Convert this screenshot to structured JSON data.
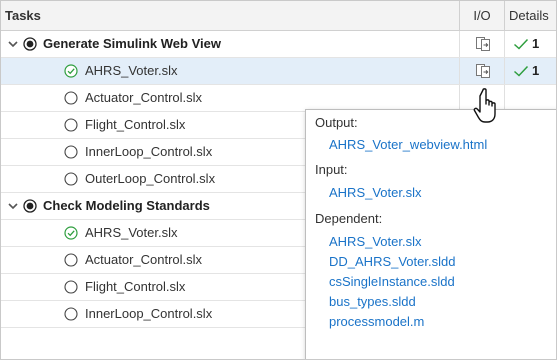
{
  "header": {
    "tasks": "Tasks",
    "io": "I/O",
    "details": "Details"
  },
  "rows": [
    {
      "label": "Generate Simulink Web View",
      "count": "1"
    },
    {
      "label": "AHRS_Voter.slx",
      "count": "1"
    },
    {
      "label": "Actuator_Control.slx"
    },
    {
      "label": "Flight_Control.slx"
    },
    {
      "label": "InnerLoop_Control.slx"
    },
    {
      "label": "OuterLoop_Control.slx"
    },
    {
      "label": "Check Modeling Standards"
    },
    {
      "label": "AHRS_Voter.slx"
    },
    {
      "label": "Actuator_Control.slx"
    },
    {
      "label": "Flight_Control.slx"
    },
    {
      "label": "InnerLoop_Control.slx"
    }
  ],
  "popup": {
    "output_title": "Output:",
    "output_files": [
      "AHRS_Voter_webview.html"
    ],
    "input_title": "Input:",
    "input_files": [
      "AHRS_Voter.slx"
    ],
    "dependent_title": "Dependent:",
    "dependent_files": [
      "AHRS_Voter.slx",
      "DD_AHRS_Voter.sldd",
      "csSingleInstance.sldd",
      "bus_types.sldd",
      "processmodel.m"
    ]
  },
  "colors": {
    "link": "#1a73c8",
    "check": "#2e9e3e",
    "selected_row": "#e3eef9"
  },
  "icons": {
    "expand": "chevron-down-icon",
    "task_selected": "radio-selected-icon",
    "task_success": "check-circle-icon",
    "task_pending": "empty-circle-icon",
    "io": "io-files-icon",
    "pass": "checkmark-icon",
    "cursor": "hand-pointer-icon"
  }
}
